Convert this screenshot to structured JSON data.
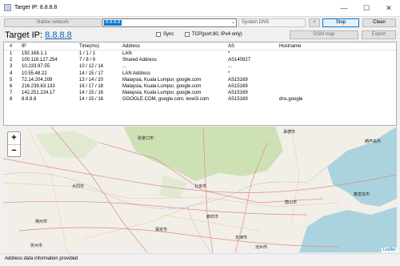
{
  "window": {
    "title": "Target IP: 8.8.8.8",
    "minimize_glyph": "—",
    "maximize_glyph": "☐",
    "close_glyph": "✕"
  },
  "toolbar": {
    "native_network_label": "Native network",
    "target_value": "8.8.8.8",
    "system_dns_label": "System DNS",
    "plus_label": "+",
    "stop_label": "Stop",
    "clean_label": "Clean"
  },
  "header": {
    "target_prefix": "Target IP:",
    "target_ip": "8.8.8.8",
    "sync_label": "Sync",
    "tcp_label": "TCP(port 80, IPv4 only)",
    "gsm_map_label": "GSM map",
    "export_label": "Export"
  },
  "table": {
    "columns": [
      "#",
      "IP",
      "Time(ms)",
      "Address",
      "AS",
      "Hostname"
    ],
    "rows": [
      [
        "1",
        "192.168.1.1",
        "1 / 1 / 1",
        "LAN",
        "*",
        ""
      ],
      [
        "2",
        "100.118.127.254",
        "7 / 8 / 9",
        "Shared Address",
        "AS140927",
        ""
      ],
      [
        "3",
        "10.233.97.55",
        "10 / 12 / 14",
        "...",
        "...",
        ""
      ],
      [
        "4",
        "10.55.48.22",
        "14 / 15 / 17",
        "LAN Address",
        "*",
        ""
      ],
      [
        "5",
        "72.14.204.208",
        "13 / 14 / 20",
        "Malaysia, Kuala Lumpur, google.com",
        "AS15169",
        ""
      ],
      [
        "6",
        "216.239.63.133",
        "16 / 17 / 18",
        "Malaysia, Kuala Lumpur, google.com",
        "AS15169",
        ""
      ],
      [
        "7",
        "142.251.224.17",
        "14 / 15 / 16",
        "Malaysia, Kuala Lumpur, google.com",
        "AS15169",
        ""
      ],
      [
        "8",
        "8.8.8.8",
        "14 / 15 / 16",
        "GOOGLE.COM, google.com, level3.com",
        "AS15169",
        "dns.google"
      ]
    ]
  },
  "map": {
    "zoom_in": "+",
    "zoom_out": "−",
    "attribution": "Leaflet",
    "labels": [
      {
        "text": "张家口市"
      },
      {
        "text": "承德市"
      },
      {
        "text": "葫芦岛市"
      },
      {
        "text": "大同市"
      },
      {
        "text": "北京市"
      },
      {
        "text": "秦皇岛市"
      },
      {
        "text": "唐山市"
      },
      {
        "text": "保定市"
      },
      {
        "text": "天津市"
      },
      {
        "text": "廊坊市"
      },
      {
        "text": "沧州市"
      },
      {
        "text": "朔州市"
      },
      {
        "text": "忻州市"
      }
    ]
  },
  "status": {
    "text": "Address data information provided"
  }
}
